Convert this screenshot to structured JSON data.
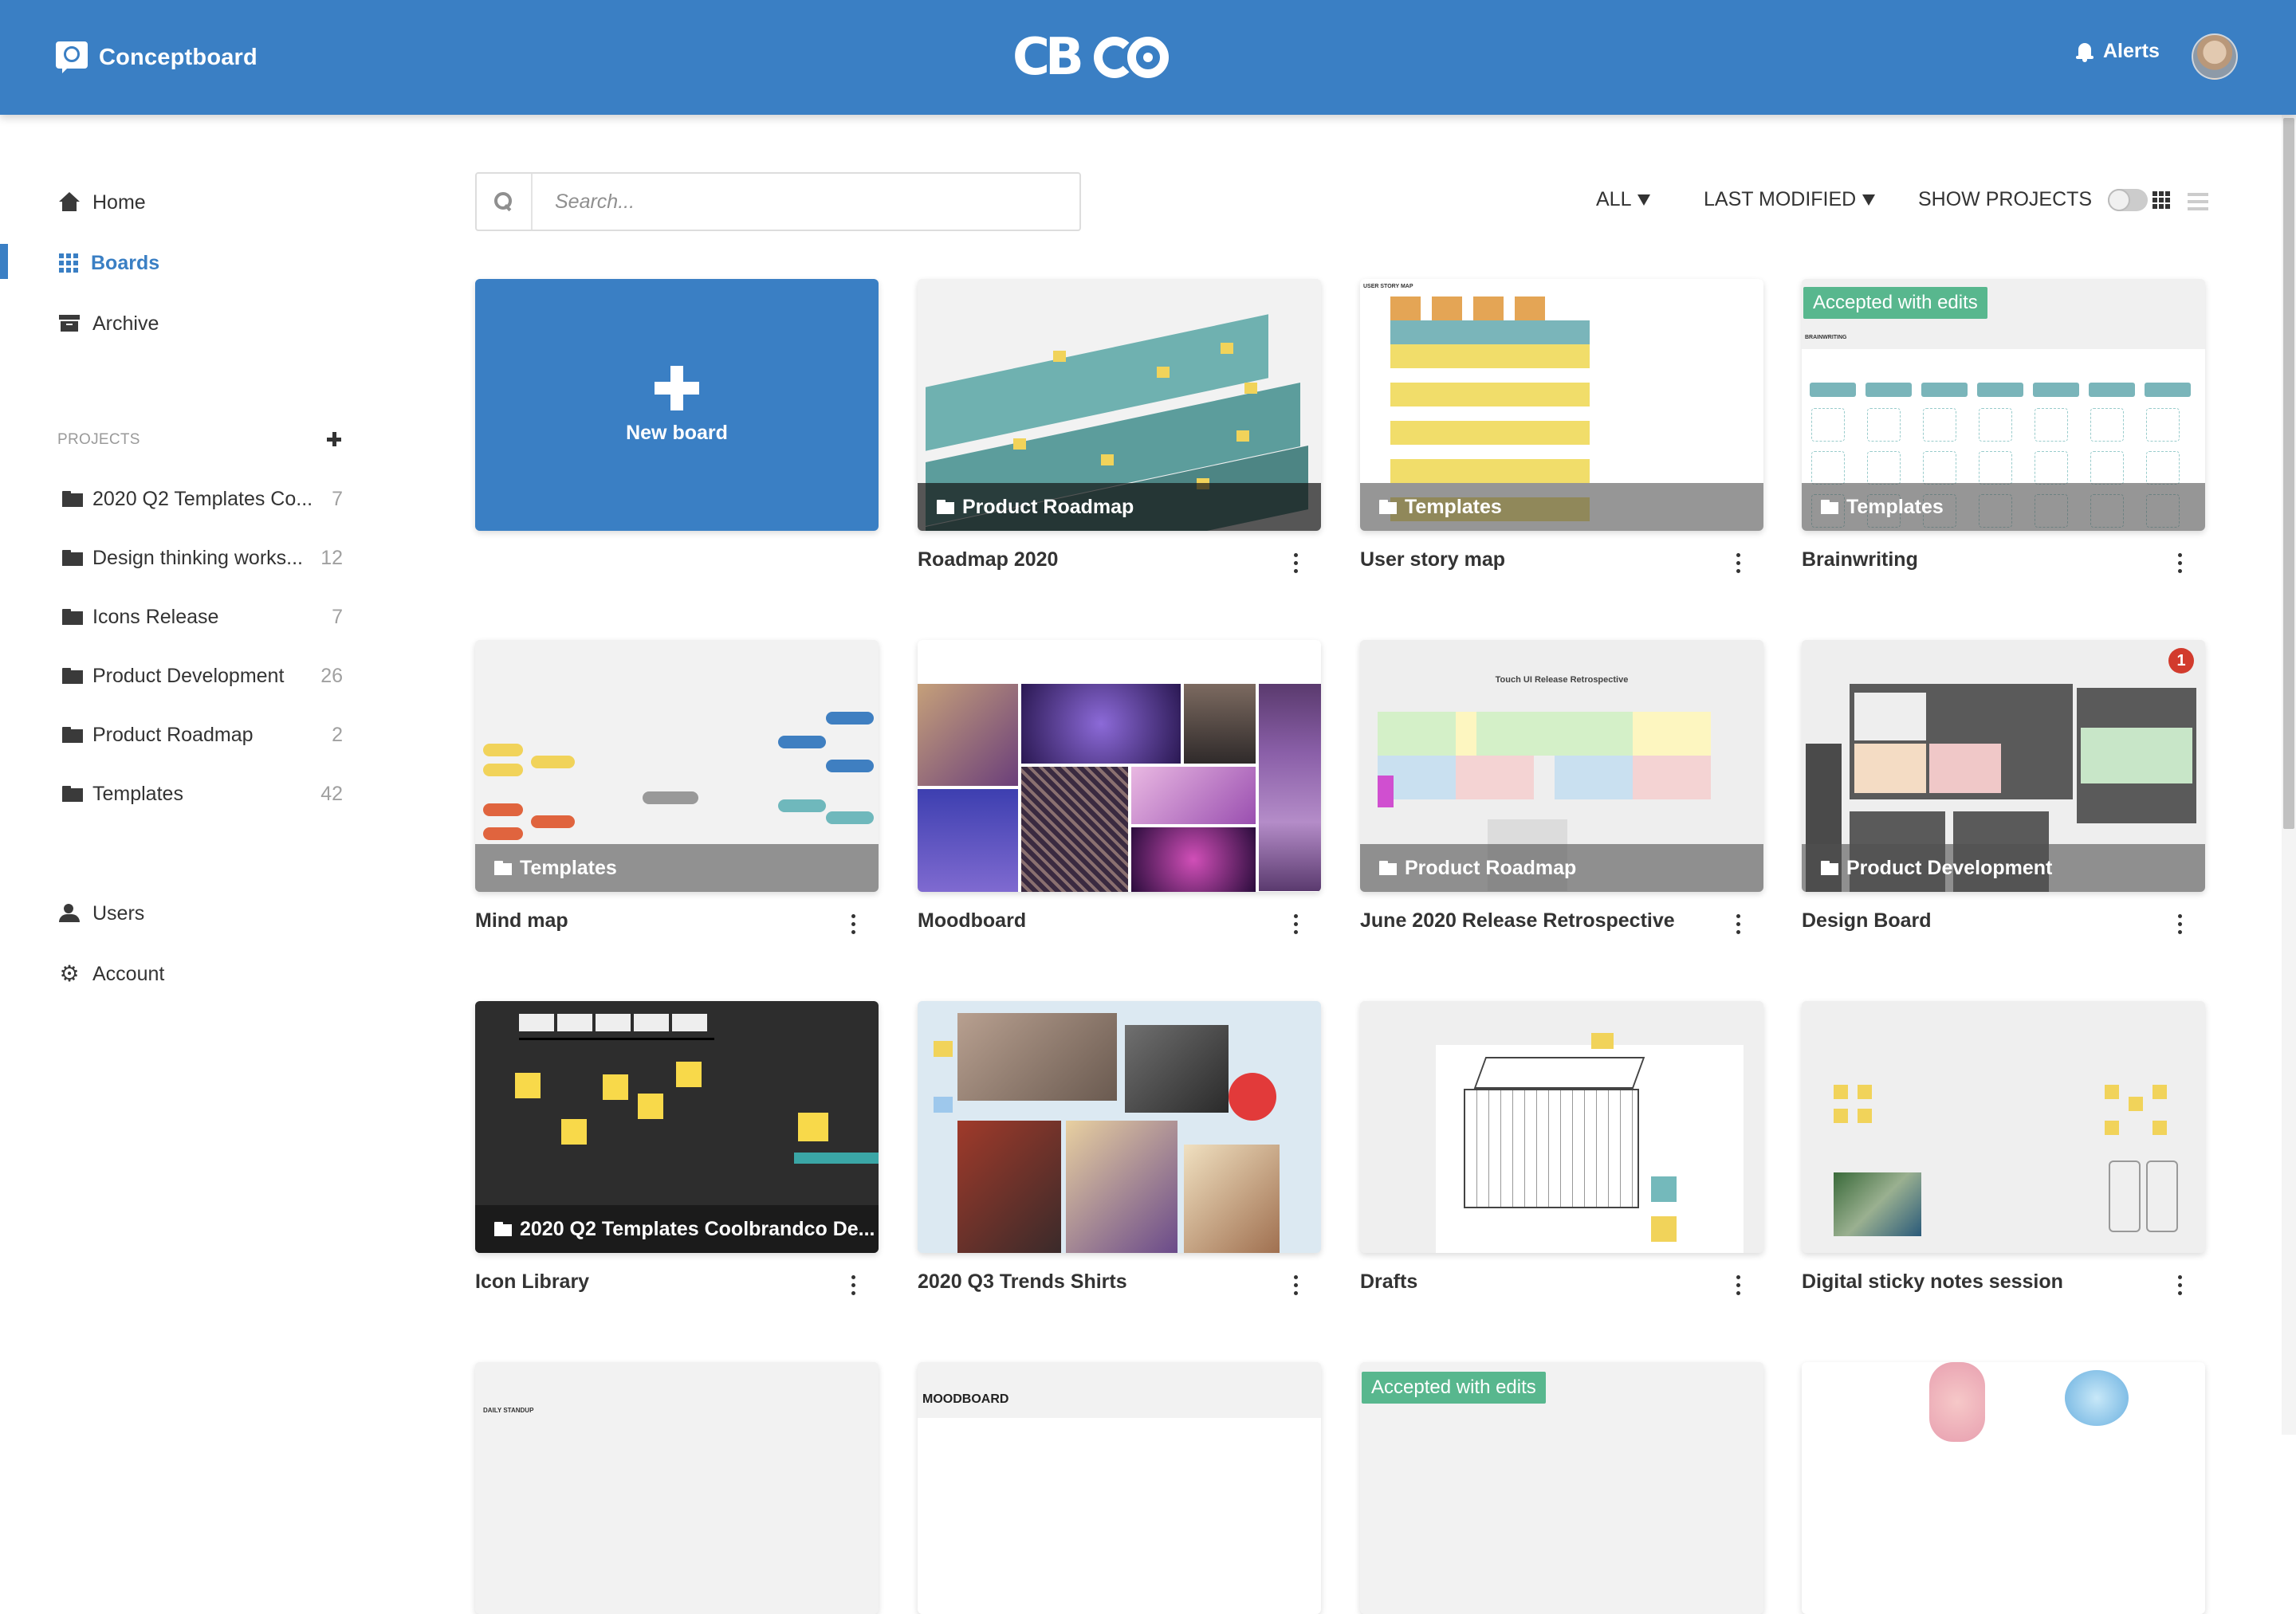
{
  "header": {
    "brand_name": "Conceptboard",
    "center_logo_text": "CB",
    "alerts_label": "Alerts",
    "user_avatar_alt": "User avatar"
  },
  "sidebar": {
    "nav": [
      {
        "label": "Home",
        "icon": "home-icon",
        "active": false
      },
      {
        "label": "Boards",
        "icon": "grid-icon",
        "active": true
      },
      {
        "label": "Archive",
        "icon": "archive-icon",
        "active": false
      }
    ],
    "projects_label": "PROJECTS",
    "projects": [
      {
        "name": "2020 Q2 Templates Co...",
        "count": "7"
      },
      {
        "name": "Design thinking works...",
        "count": "12"
      },
      {
        "name": "Icons Release",
        "count": "7"
      },
      {
        "name": "Product Development",
        "count": "26"
      },
      {
        "name": "Product Roadmap",
        "count": "2"
      },
      {
        "name": "Templates",
        "count": "42"
      }
    ],
    "bottom_nav": [
      {
        "label": "Users",
        "icon": "users-icon"
      },
      {
        "label": "Account",
        "icon": "gear-icon"
      }
    ]
  },
  "toolbar": {
    "search_placeholder": "Search...",
    "search_value": "",
    "filter_label": "ALL",
    "sort_label": "LAST MODIFIED",
    "show_projects_label": "SHOW PROJECTS",
    "show_projects_on": false,
    "view_mode": "grid"
  },
  "new_board_label": "New board",
  "boards": [
    {
      "title": "Roadmap 2020",
      "project": "Product Roadmap",
      "badge": null,
      "notifications": null
    },
    {
      "title": "User story map",
      "project": "Templates",
      "badge": null,
      "notifications": null
    },
    {
      "title": "Brainwriting",
      "project": "Templates",
      "badge": "Accepted with edits",
      "notifications": null
    },
    {
      "title": "Mind map",
      "project": "Templates",
      "badge": null,
      "notifications": null
    },
    {
      "title": "Moodboard",
      "project": null,
      "badge": null,
      "notifications": null
    },
    {
      "title": "June 2020 Release Retrospective",
      "project": "Product Roadmap",
      "badge": null,
      "notifications": null
    },
    {
      "title": "Design Board",
      "project": "Product Development",
      "badge": null,
      "notifications": "1"
    },
    {
      "title": "Icon Library",
      "project": "2020 Q2 Templates Coolbrandco De...",
      "badge": null,
      "notifications": null
    },
    {
      "title": "2020 Q3 Trends Shirts",
      "project": null,
      "badge": null,
      "notifications": null
    },
    {
      "title": "Drafts",
      "project": null,
      "badge": null,
      "notifications": null
    },
    {
      "title": "Digital sticky notes session",
      "project": null,
      "badge": null,
      "notifications": null
    },
    {
      "title": "",
      "project": null,
      "badge": null,
      "notifications": null,
      "thumb_text": "DAILY STANDUP"
    },
    {
      "title": "",
      "project": null,
      "badge": null,
      "notifications": null,
      "thumb_text": "MOODBOARD"
    },
    {
      "title": "",
      "project": null,
      "badge": "Accepted with edits",
      "notifications": null
    },
    {
      "title": "",
      "project": null,
      "badge": null,
      "notifications": null
    }
  ],
  "thumb_texts": {
    "retro_heading": "Touch UI Release Retrospective",
    "usm_heading": "USER STORY MAP",
    "brain_heading": "BRAINWRITING"
  },
  "colors": {
    "brand_blue": "#3a7fc4",
    "badge_green": "#58b78e",
    "notification_red": "#d23b2d"
  }
}
